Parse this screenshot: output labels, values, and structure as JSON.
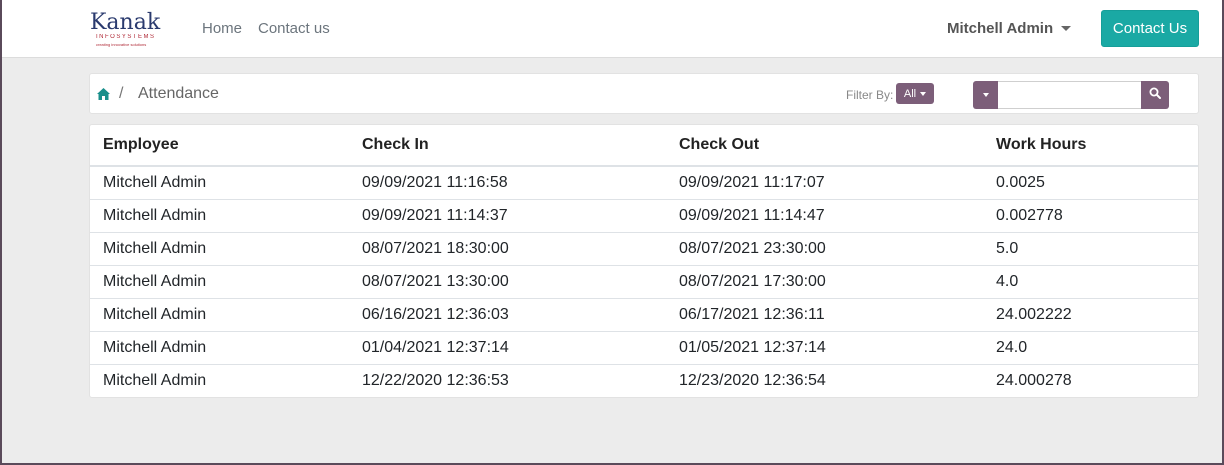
{
  "navbar": {
    "logo_text": "Kanak",
    "logo_sub": "INFOSYSTEMS",
    "logo_tag": "creating innovative solutions",
    "links": [
      "Home",
      "Contact us"
    ],
    "user_name": "Mitchell Admin",
    "contact_button": "Contact Us"
  },
  "breadcrumb": {
    "separator": "/",
    "current": "Attendance"
  },
  "filter": {
    "label": "Filter By:",
    "value": "All"
  },
  "search": {
    "value": "",
    "placeholder": ""
  },
  "table": {
    "headers": [
      "Employee",
      "Check In",
      "Check Out",
      "Work Hours"
    ],
    "rows": [
      [
        "Mitchell Admin",
        "09/09/2021 11:16:58",
        "09/09/2021 11:17:07",
        "0.0025"
      ],
      [
        "Mitchell Admin",
        "09/09/2021 11:14:37",
        "09/09/2021 11:14:47",
        "0.002778"
      ],
      [
        "Mitchell Admin",
        "08/07/2021 18:30:00",
        "08/07/2021 23:30:00",
        "5.0"
      ],
      [
        "Mitchell Admin",
        "08/07/2021 13:30:00",
        "08/07/2021 17:30:00",
        "4.0"
      ],
      [
        "Mitchell Admin",
        "06/16/2021 12:36:03",
        "06/17/2021 12:36:11",
        "24.002222"
      ],
      [
        "Mitchell Admin",
        "01/04/2021 12:37:14",
        "01/05/2021 12:37:14",
        "24.0"
      ],
      [
        "Mitchell Admin",
        "12/22/2020 12:36:53",
        "12/23/2020 12:36:54",
        "24.000278"
      ]
    ]
  },
  "colors": {
    "accent": "#1aa9a4",
    "filter_button": "#7c5e79",
    "background": "#ececec"
  },
  "icons": {
    "home": "home-icon",
    "search": "search-icon",
    "caret": "chevron-down-icon"
  }
}
